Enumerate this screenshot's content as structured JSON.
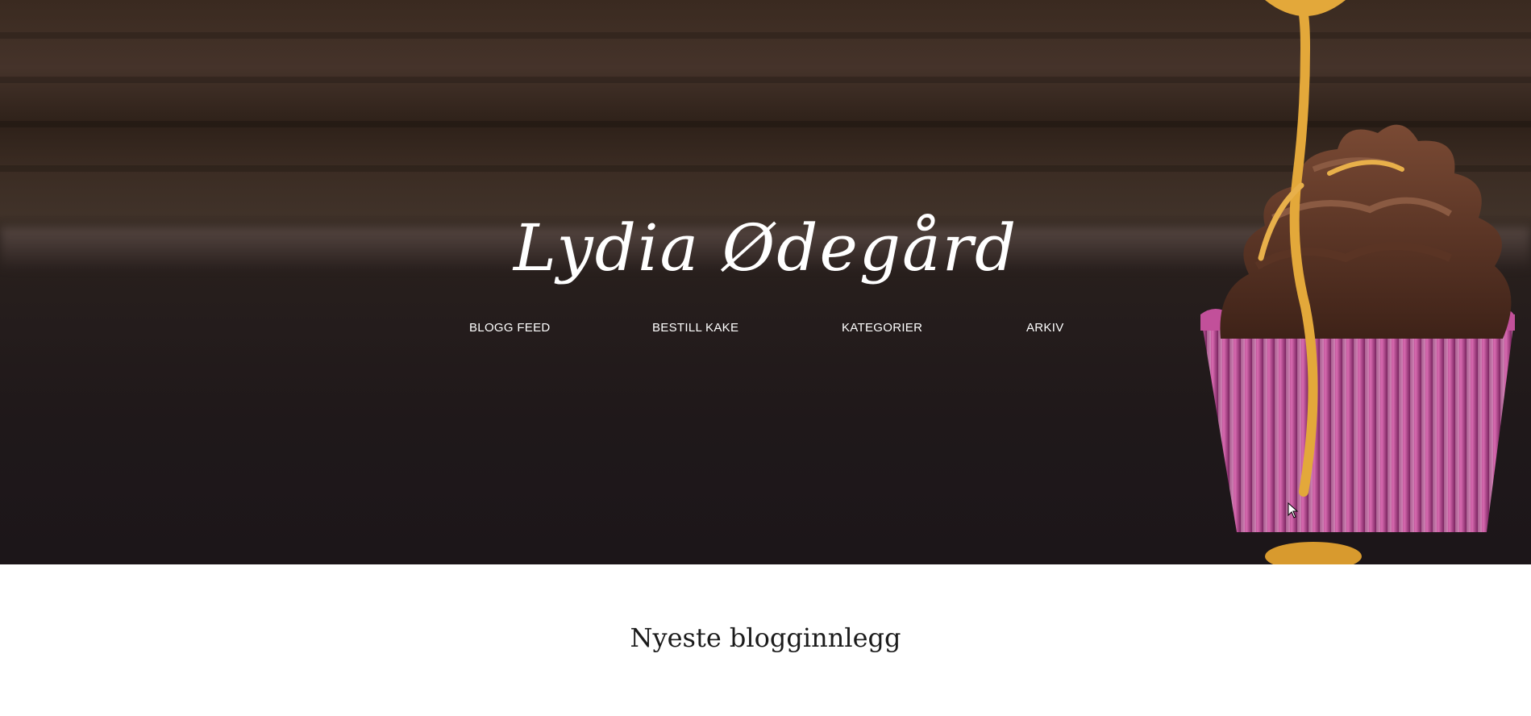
{
  "site": {
    "title": "Lydia Ødegård"
  },
  "nav": {
    "items": [
      {
        "label": "BLOGG FEED"
      },
      {
        "label": "BESTILL KAKE"
      },
      {
        "label": "KATEGORIER"
      },
      {
        "label": "ARKIV"
      }
    ]
  },
  "main": {
    "section_heading": "Nyeste blogginnlegg"
  },
  "colors": {
    "hero_dark": "#1f181a",
    "wood": "#3a2a20",
    "text_light": "#ffffff",
    "heading_dark": "#1b1b1b",
    "caramel": "#e3a83a",
    "frosting": "#5a3424",
    "liner_pink": "#c2509a"
  }
}
